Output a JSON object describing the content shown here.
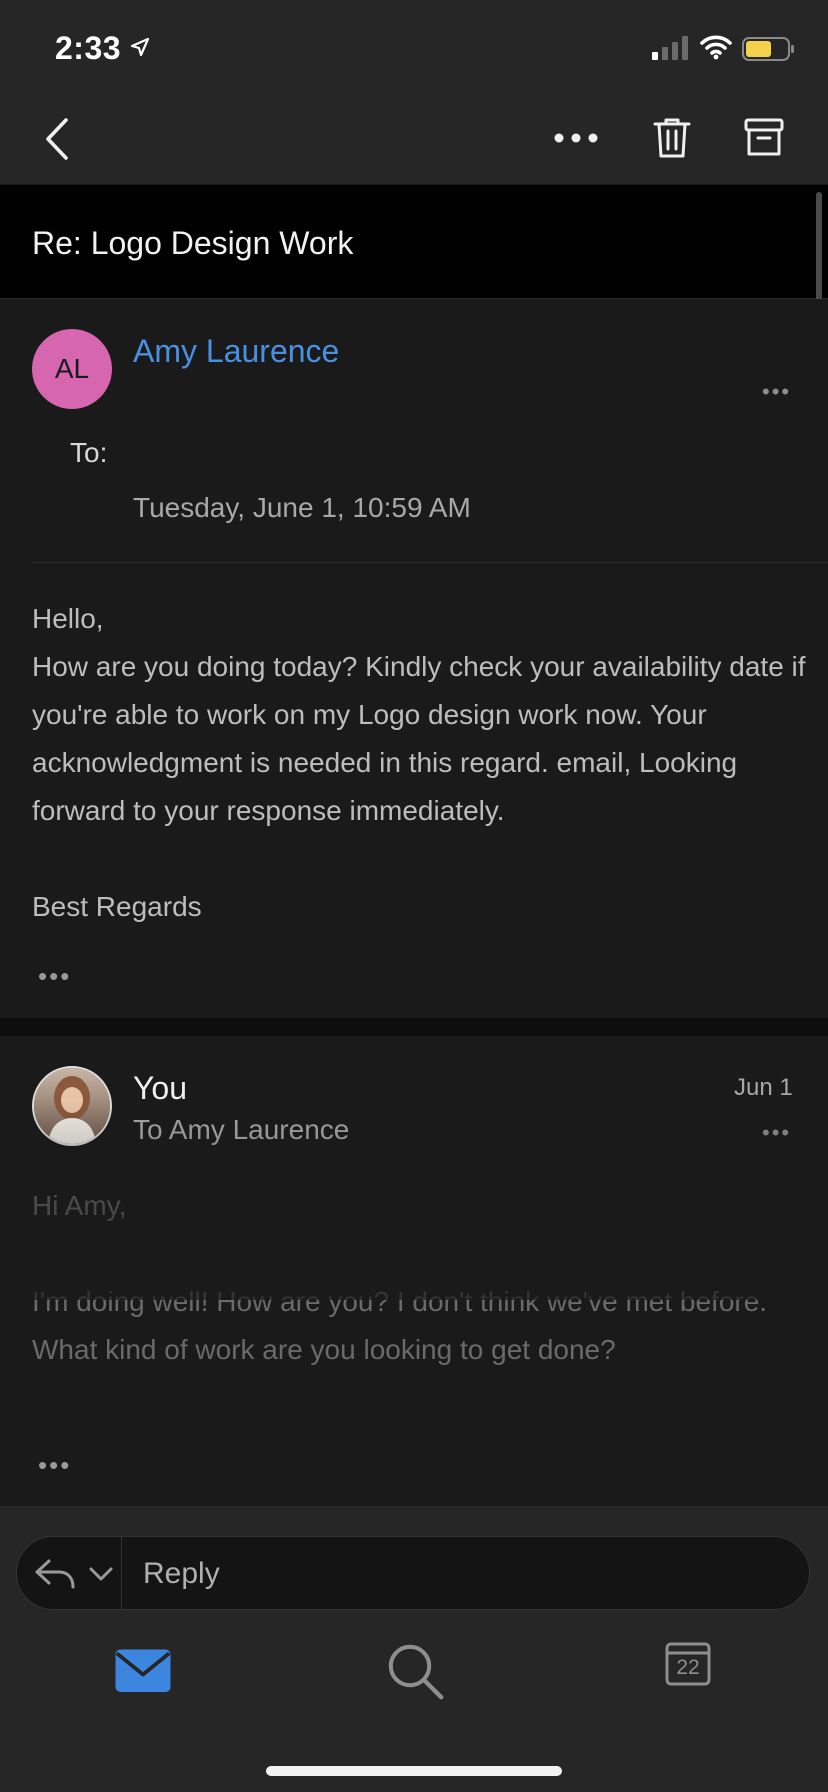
{
  "status_bar": {
    "time": "2:33",
    "icons": [
      "location-arrow-icon",
      "cellular-signal-icon",
      "wifi-icon",
      "battery-icon"
    ],
    "battery_color": "#f3d14a"
  },
  "toolbar": {
    "icons": [
      "back-chevron-icon",
      "more-icon",
      "trash-icon",
      "archive-icon"
    ]
  },
  "thread": {
    "subject": "Re: Logo Design Work"
  },
  "message1": {
    "avatar_initials": "AL",
    "avatar_color": "#d766b0",
    "sender": "Amy Laurence",
    "sender_color": "#4a90e2",
    "to_label": "To:",
    "date": "Tuesday, June 1, 10:59 AM",
    "greeting": "Hello,",
    "body": "How are you doing today? Kindly check your availability date if you're able to work on my Logo design work now. Your acknowledgment is needed in this regard. email, Looking forward to your response immediately.",
    "signoff": "Best Regards",
    "more": "•••"
  },
  "message2": {
    "sender": "You",
    "recipient": "To Amy Laurence",
    "date": "Jun 1",
    "greeting": "Hi Amy,",
    "body": "I'm doing well! How are you? I don't think we've met before. What kind of work are you looking to get done?",
    "more": "•••"
  },
  "reply": {
    "placeholder": "Reply"
  },
  "tab_bar": {
    "items": [
      {
        "icon": "mail-icon",
        "active": true
      },
      {
        "icon": "search-icon",
        "active": false
      },
      {
        "icon": "calendar-icon",
        "active": false,
        "badge": "22"
      }
    ],
    "active_color": "#3d86e0"
  }
}
